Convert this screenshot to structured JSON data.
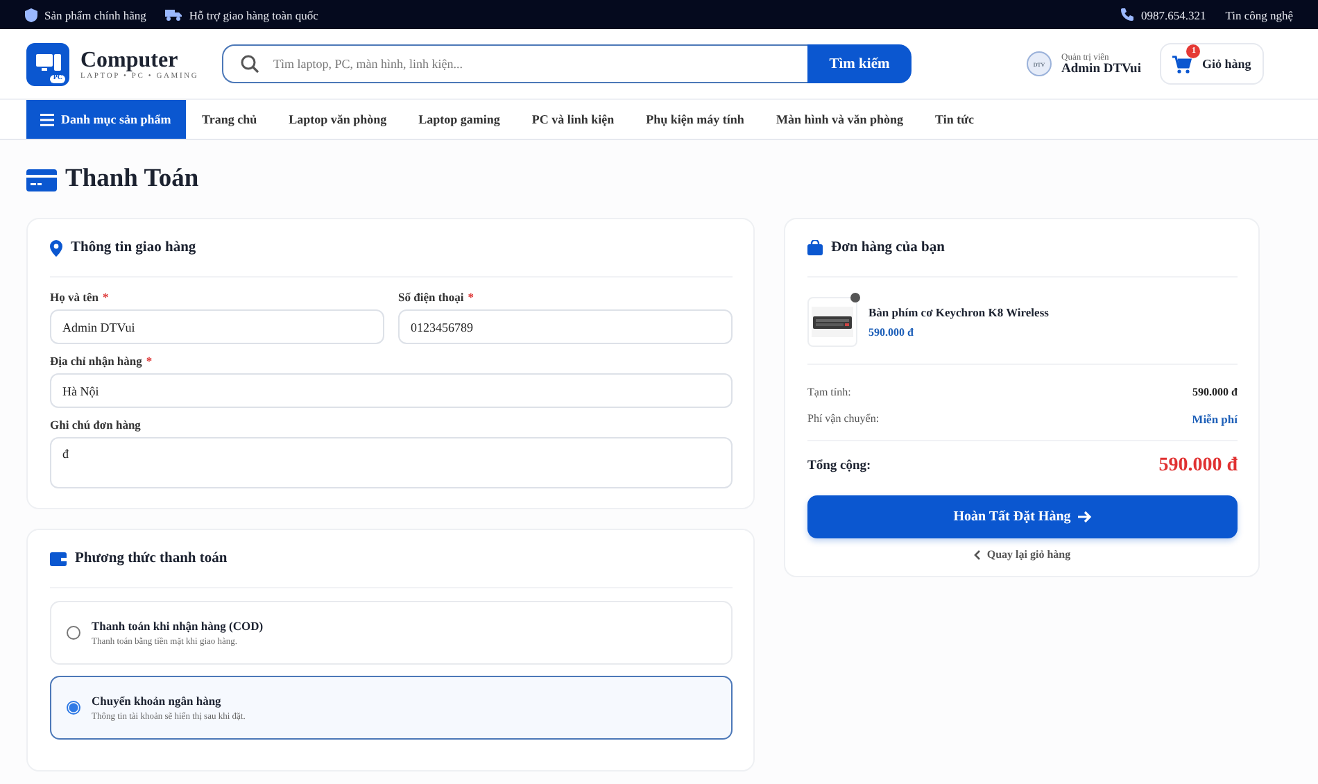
{
  "topbar": {
    "left": [
      {
        "kind": "shield",
        "text": "Sản phẩm chính hãng"
      },
      {
        "kind": "truck",
        "text": "Hỗ trợ giao hàng toàn quốc"
      }
    ],
    "phone": "0987.654.321",
    "link": "Tin công nghệ"
  },
  "header": {
    "logo": {
      "badge": "PC",
      "name": "Computer",
      "tagline": "LAPTOP • PC • GAMING"
    },
    "search": {
      "placeholder": "Tìm laptop, PC, màn hình, linh kiện...",
      "button": "Tìm kiếm"
    },
    "user": {
      "avatar": "DTV",
      "role": "Quản trị viên",
      "name": "Admin DTVui"
    },
    "cart": {
      "count": "1",
      "label": "Giỏ hàng"
    }
  },
  "nav": {
    "category": "Danh mục sản phẩm",
    "items": [
      "Trang chủ",
      "Laptop văn phòng",
      "Laptop gaming",
      "PC và linh kiện",
      "Phụ kiện máy tính",
      "Màn hình và văn phòng",
      "Tin tức"
    ]
  },
  "page_title": "Thanh Toán",
  "shipping": {
    "title": "Thông tin giao hàng",
    "fields": [
      {
        "label": "Họ và tên",
        "required_mark": "*",
        "value": "Admin DTVui",
        "kind": "input"
      },
      {
        "label": "Số điện thoại",
        "required_mark": "*",
        "value": "0123456789",
        "kind": "input"
      },
      {
        "label": "Địa chỉ nhận hàng",
        "required_mark": "*",
        "value": "Hà Nội",
        "kind": "input"
      },
      {
        "label": "Ghi chú đơn hàng",
        "value": "đ",
        "kind": "textarea"
      }
    ]
  },
  "payment": {
    "title": "Phương thức thanh toán",
    "methods": [
      {
        "name": "Thanh toán khi nhận hàng (COD)",
        "note": "Thanh toán bằng tiền mặt khi giao hàng.",
        "selected": false
      },
      {
        "name": "Chuyển khoản ngân hàng",
        "note": "Thông tin tài khoản sẽ hiển thị sau khi đặt.",
        "selected": true
      }
    ]
  },
  "order": {
    "title": "Đơn hàng của bạn",
    "items": [
      {
        "kind": "picture",
        "name": "Bàn phím cơ Keychron K8 Wireless",
        "price": "590.000 đ"
      }
    ],
    "summary": [
      {
        "label": "Tạm tính:",
        "value": "590.000 đ",
        "kind": "plain"
      },
      {
        "label": "Phí vận chuyển:",
        "value": "Miễn phí",
        "kind": "accent"
      }
    ],
    "total_label": "Tổng cộng:",
    "total": "590.000 đ",
    "submit": "Hoàn Tất Đặt Hàng",
    "back": "Quay lại giỏ hàng"
  }
}
